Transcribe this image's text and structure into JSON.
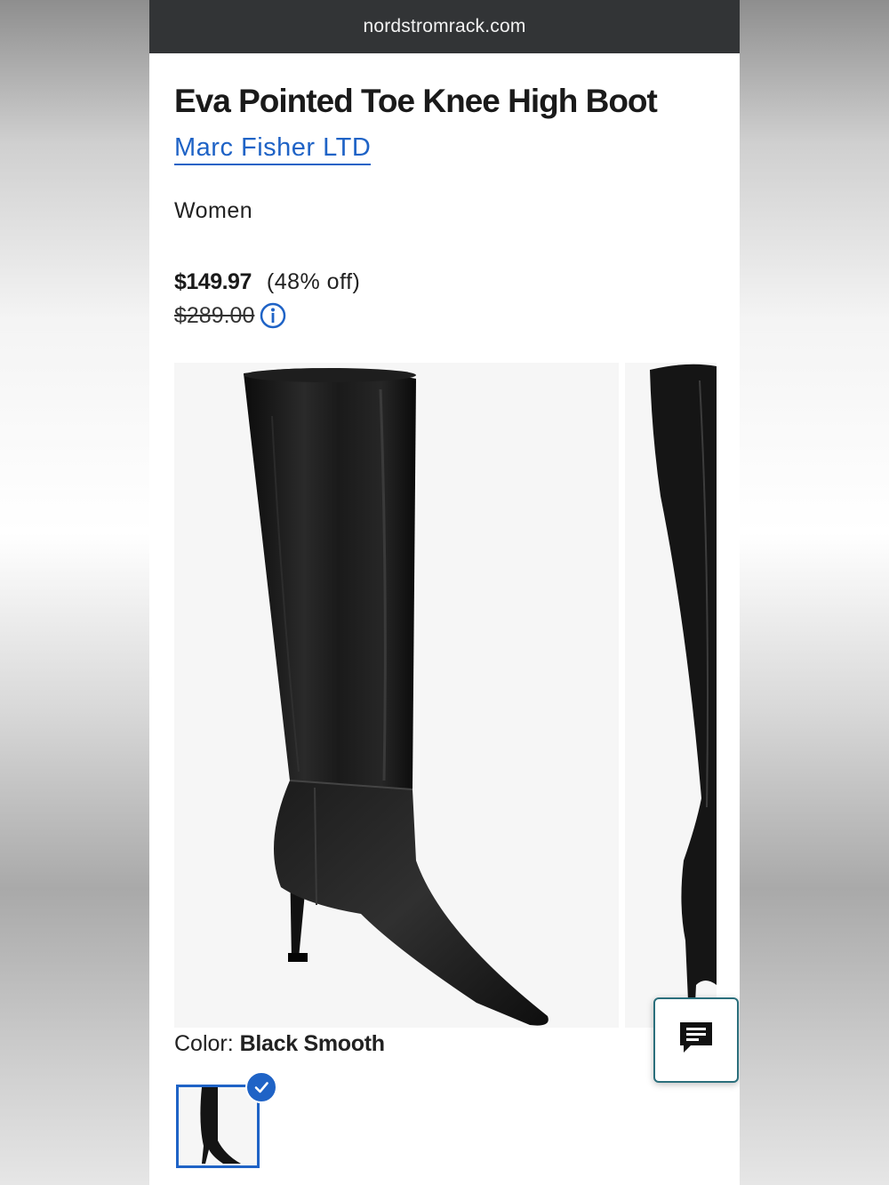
{
  "browser": {
    "url": "nordstromrack.com"
  },
  "product": {
    "title": "Eva Pointed Toe Knee High Boot",
    "brand": "Marc Fisher LTD",
    "department": "Women",
    "price": "$149.97",
    "discount": "(48% off)",
    "original_price": "$289.00",
    "color_label": "Color:",
    "color_value": "Black Smooth"
  },
  "icons": {
    "info": "info-circle-icon",
    "chat": "chat-bubble-icon",
    "selected": "checkmark-icon"
  },
  "colors": {
    "link_blue": "#1f63c6",
    "url_bar": "#323436",
    "chat_border": "#2b6f7c"
  }
}
